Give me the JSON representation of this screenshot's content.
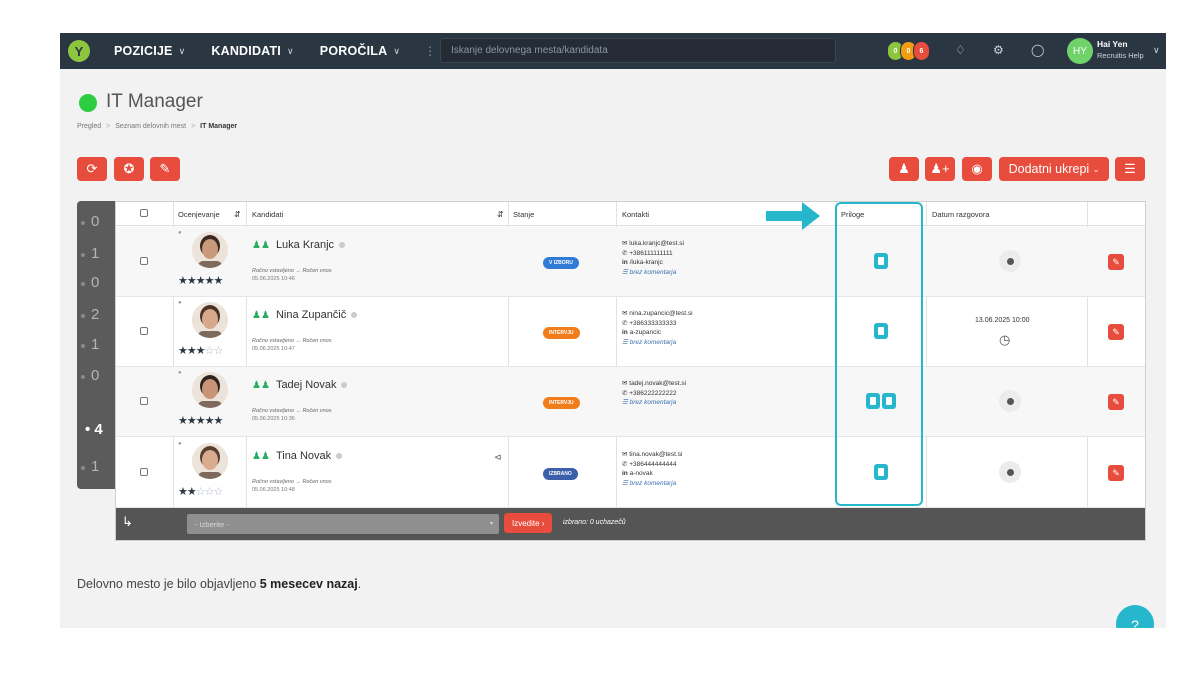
{
  "topbar": {
    "menu": [
      {
        "label": "POZICIJE"
      },
      {
        "label": "KANDIDATI"
      },
      {
        "label": "POROČILA"
      }
    ],
    "search_placeholder": "Iskanje delovnega mesta/kandidata",
    "badges": [
      {
        "count": "0",
        "color": "#8cc63f"
      },
      {
        "count": "0",
        "color": "#f39c12"
      },
      {
        "count": "6",
        "color": "#e74c3c"
      }
    ],
    "user": {
      "initials": "HY",
      "name": "Hai Yen",
      "subtitle": "Recruitis Help"
    }
  },
  "page": {
    "title": "IT Manager",
    "breadcrumb": [
      "Pregled",
      "Seznam delovnih mest",
      "IT Manager"
    ],
    "actions": {
      "more_label": "Dodatni ukrepi"
    }
  },
  "rating_filter": {
    "values": [
      "0",
      "1",
      "0",
      "2",
      "1",
      "0",
      "4",
      "1"
    ],
    "active_index": 6
  },
  "table": {
    "headers": {
      "rating": "Ocenjevanje",
      "candidates": "Kandidati",
      "state": "Stanje",
      "contacts": "Kontakti",
      "attachments": "Priloge",
      "interview_date": "Datum razgovora"
    },
    "rows": [
      {
        "name": "Luka Kranjc",
        "stars": 5,
        "source": "Ročno vstavljeno → Ročen vnos",
        "date": "05.06.2025 10:46",
        "state": "V IZBORU",
        "state_color": "#2f7bd6",
        "email": "luka.kranjc@test.si",
        "phone": "+386111111111",
        "linkedin": "/luka-kranjc",
        "comment": "brez komentarja",
        "attachments": 1,
        "interview": ""
      },
      {
        "name": "Nina Zupančič",
        "stars": 3,
        "source": "Ročno vstavljeno → Ročen vnos",
        "date": "05.06.2025 10:47",
        "state": "INTERVJU",
        "state_color": "#f07c1a",
        "email": "nina.zupancic@test.si",
        "phone": "+386333333333",
        "linkedin": "a-zupancic",
        "comment": "brez komentarja",
        "attachments": 1,
        "interview": "13.06.2025 10:00"
      },
      {
        "name": "Tadej Novak",
        "stars": 5,
        "source": "Ročno vstavljeno → Ročen vnos",
        "date": "05.06.2025 10:36",
        "state": "INTERVJU",
        "state_color": "#f07c1a",
        "email": "tadej.novak@test.si",
        "phone": "+386222222222",
        "linkedin": "",
        "comment": "brez komentarja",
        "attachments": 2,
        "interview": ""
      },
      {
        "name": "Tina Novak",
        "stars": 2,
        "source": "Ročno vstavljeno → Ročen vnos",
        "date": "05.06.2025 10:48",
        "state": "IZBRANO",
        "state_color": "#3b5fa8",
        "email": "tina.novak@test.si",
        "phone": "+386444444444",
        "linkedin": "a-novak",
        "comment": "brez komentarja",
        "attachments": 1,
        "interview": ""
      }
    ],
    "footer": {
      "select_placeholder": "- Izberite -",
      "go_label": "Izvedite ›",
      "selected_text": "izbrano: 0 uchazečů"
    }
  },
  "published": {
    "prefix": "Delovno mesto je bilo objavljeno ",
    "bold": "5 mesecev nazaj",
    "suffix": "."
  },
  "help_label": "?",
  "annotation_color": "#26b7cc"
}
